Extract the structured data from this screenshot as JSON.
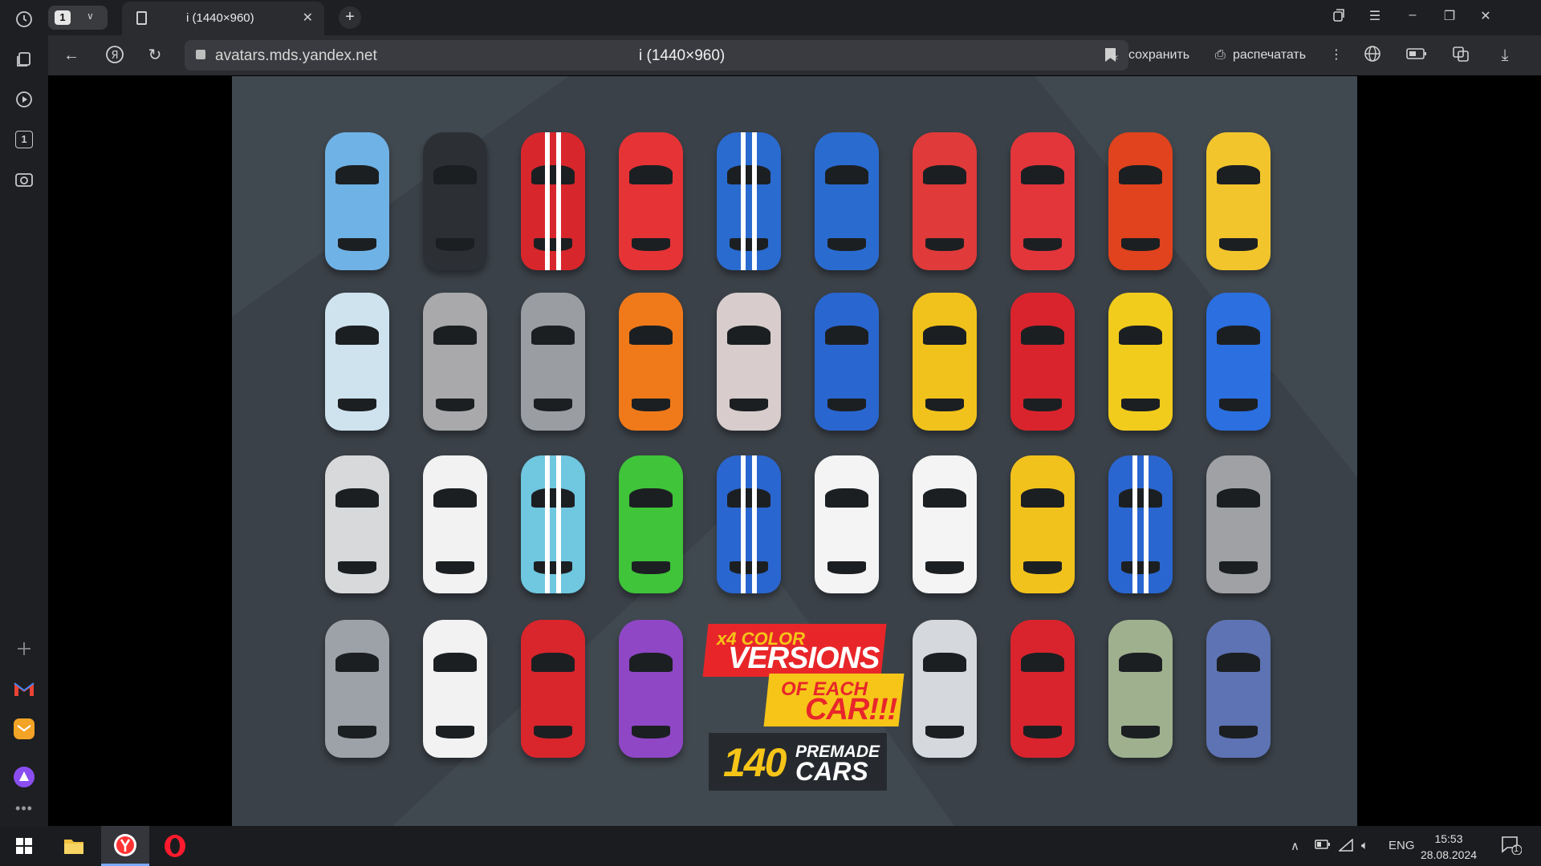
{
  "browser": {
    "tab_count": "1",
    "tab_title": "i (1440×960)",
    "url_host": "avatars.mds.yandex.net",
    "page_title": "i (1440×960)",
    "save_label": "сохранить",
    "print_label": "распечатать"
  },
  "sidebar": {
    "tab_counter": "1",
    "icons": [
      "history-icon",
      "collections-icon",
      "video-icon",
      "tabs-counter-icon",
      "screenshot-icon",
      "add-icon",
      "gmail-icon",
      "mail-icon",
      "alice-icon",
      "more-icon"
    ]
  },
  "image": {
    "cars": [
      [
        "#6fb2e6",
        "#2c3035",
        "#d7262c",
        "#e63336",
        "#2a6bd0",
        "#2a6bd0",
        "#e03a3a",
        "#e3363b",
        "#e0431d",
        "#f2c52c"
      ],
      [
        "#cfe3ef",
        "#a9a9ab",
        "#9a9ea3",
        "#f07a1a",
        "#d8cccc",
        "#2a66d0",
        "#f2c21c",
        "#d9242d",
        "#f2cc1c",
        "#2b6fe0"
      ],
      [
        "#d8d9db",
        "#f2f2f2",
        "#6fc7e0",
        "#3fc43a",
        "#2a66d0",
        "#f4f4f4",
        "#f4f4f4",
        "#f2c21c",
        "#2a66d0",
        "#9fa1a4"
      ],
      [
        "#9da2a8",
        "#f2f2f2",
        "#d9252c",
        "#8f47c6",
        "",
        "",
        "#d5d8dc",
        "#d9242d",
        "#9fb08e",
        "#5d73b3"
      ]
    ],
    "promo": {
      "line1": "x4 COLOR",
      "line2": "VERSIONS",
      "line3": "OF EACH",
      "line4": "CAR!!!",
      "count": "140",
      "line5": "PREMADE",
      "line6": "CARS"
    }
  },
  "taskbar": {
    "apps": [
      "windows-start-icon",
      "file-explorer-icon",
      "yandex-browser-icon",
      "opera-icon"
    ],
    "lang": "ENG",
    "time": "15:53",
    "date": "28.08.2024",
    "notifications": "1"
  }
}
